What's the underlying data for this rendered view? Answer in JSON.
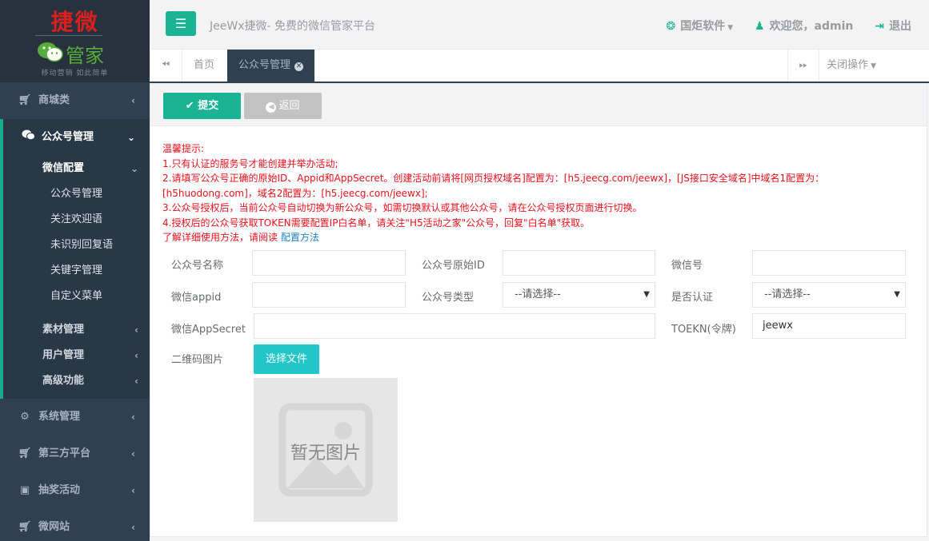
{
  "logo": {
    "title": "捷微",
    "word": "管家",
    "slogan": "移动营销  如此简单"
  },
  "sidebar": {
    "items": [
      {
        "label": "商城类",
        "icon": "cart-icon"
      },
      {
        "label": "公众号管理",
        "icon": "wechat-icon"
      },
      {
        "label": "系统管理",
        "icon": "gear-icon"
      },
      {
        "label": "第三方平台",
        "icon": "cart-icon"
      },
      {
        "label": "抽奖活动",
        "icon": "gift-icon"
      },
      {
        "label": "微网站",
        "icon": "cart-icon"
      }
    ],
    "sub": {
      "weixin_config": "微信配置",
      "children": [
        "公众号管理",
        "关注欢迎语",
        "未识别回复语",
        "关键字管理",
        "自定义菜单"
      ],
      "others": [
        "素材管理",
        "用户管理",
        "高级功能"
      ]
    }
  },
  "topbar": {
    "title": "JeeWx捷微- 免费的微信管家平台",
    "company": "国炬软件",
    "welcome": "欢迎您，admin",
    "logout": "退出"
  },
  "tabs": {
    "home": "首页",
    "active": "公众号管理",
    "close_ops": "关闭操作"
  },
  "toolbar": {
    "submit": "提交",
    "back": "返回"
  },
  "notice": {
    "line1": "温馨提示:",
    "line2": "1.只有认证的服务号才能创建并举办活动;",
    "line3": "2.请填写公众号正确的原始ID、Appid和AppSecret。创建活动前请将[网页授权域名]配置为：[h5.jeecg.com/jeewx]，[JS接口安全域名]中域名1配置为：[h5huodong.com]，域名2配置为：[h5.jeecg.com/jeewx];",
    "line4": "3.公众号授权后，当前公众号自动切换为新公众号，如需切换默认或其他公众号，请在公众号授权页面进行切换。",
    "line5": "4.授权后的公众号获取TOKEN需要配置IP白名单，请关注\"H5活动之家\"公众号，回复\"白名单\"获取。",
    "line6_prefix": "了解详细使用方法，请阅读",
    "line6_link": "配置方法"
  },
  "form": {
    "name_label": "公众号名称",
    "origin_id_label": "公众号原始ID",
    "wechat_no_label": "微信号",
    "appid_label": "微信appid",
    "type_label": "公众号类型",
    "type_value": "--请选择--",
    "auth_label": "是否认证",
    "auth_value": "--请选择--",
    "secret_label": "微信AppSecret",
    "token_label": "TOEKN(令牌)",
    "token_value": "jeewx",
    "qrcode_label": "二维码图片",
    "file_button": "选择文件",
    "no_image": "暂无图片"
  },
  "colors": {
    "sidebar": "#2f4050",
    "accent": "#1ab394",
    "notice": "#e8111c",
    "link": "#1c84c6",
    "file_button": "#23c6c8"
  }
}
